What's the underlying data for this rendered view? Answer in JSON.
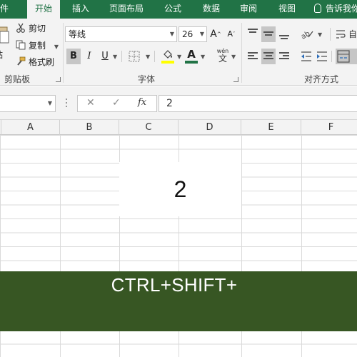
{
  "ribbon": {
    "tabs": [
      {
        "label": "件",
        "active": false
      },
      {
        "label": "开始",
        "active": true
      },
      {
        "label": "插入",
        "active": false
      },
      {
        "label": "页面布局",
        "active": false
      },
      {
        "label": "公式",
        "active": false
      },
      {
        "label": "数据",
        "active": false
      },
      {
        "label": "审阅",
        "active": false
      },
      {
        "label": "视图",
        "active": false
      }
    ],
    "tell_me": "告诉我你",
    "clipboard": {
      "paste_label": "贴",
      "cut_label": "剪切",
      "copy_label": "复制",
      "format_painter_label": "格式刷",
      "group_label": "剪贴板"
    },
    "font": {
      "font_name": "等线",
      "font_size": "26",
      "bold": "B",
      "italic": "I",
      "underline": "U",
      "increase_size": "A",
      "decrease_size": "A",
      "font_color_letter": "A",
      "phonetic_top": "wén",
      "phonetic_bottom": "文",
      "group_label": "字体"
    },
    "alignment": {
      "group_label": "对齐方式",
      "wrap_label": "自"
    },
    "colors": {
      "accent": "#217346",
      "font_color_bar": "#217346",
      "fill_color_bar": "#ffff00"
    }
  },
  "formula_bar": {
    "cancel": "✕",
    "enter": "✓",
    "fx": "fx",
    "value": "2"
  },
  "sheet": {
    "columns": [
      "A",
      "B",
      "C",
      "D",
      "E",
      "F"
    ],
    "merged_cell_value": "2"
  },
  "banner": {
    "text": "CTRL+SHIFT+",
    "color": "#375623"
  }
}
